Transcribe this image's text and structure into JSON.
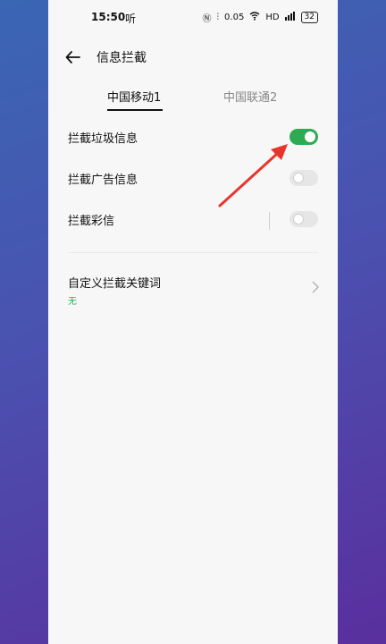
{
  "status_bar": {
    "time": "15:50",
    "app_label": "听",
    "speed": "0.05",
    "battery": "32"
  },
  "header": {
    "title": "信息拦截"
  },
  "tabs": [
    {
      "label": "中国移动1",
      "active": true
    },
    {
      "label": "中国联通2",
      "active": false
    }
  ],
  "settings": [
    {
      "label": "拦截垃圾信息",
      "on": true
    },
    {
      "label": "拦截广告信息",
      "on": false
    },
    {
      "label": "拦截彩信",
      "on": false
    }
  ],
  "custom_keywords": {
    "label": "自定义拦截关键词",
    "value": "无"
  },
  "colors": {
    "accent": "#2eaa52",
    "annotation": "#e8352b"
  }
}
